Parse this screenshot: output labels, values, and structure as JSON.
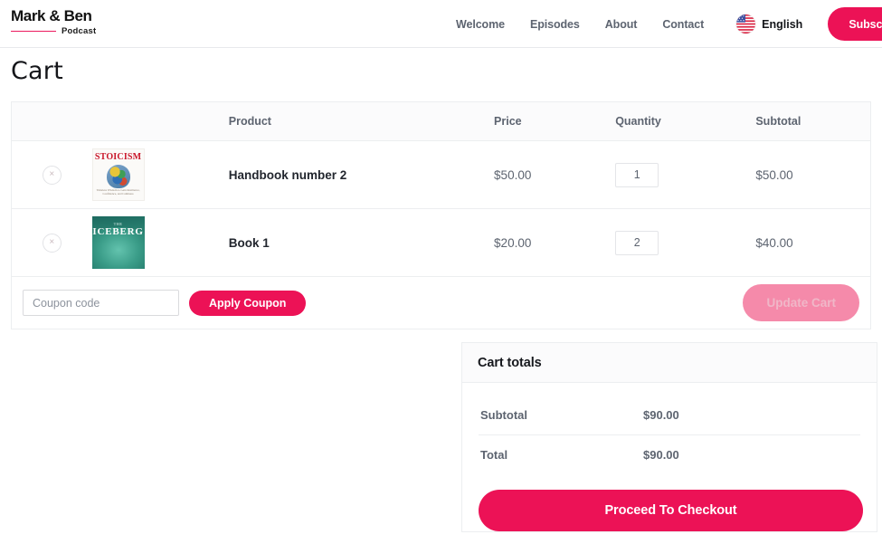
{
  "header": {
    "brand": {
      "name": "Mark & Ben",
      "tagline": "Podcast",
      "accent_color": "#ec1a5e"
    },
    "nav": [
      {
        "label": "Welcome",
        "name": "nav-link-welcome"
      },
      {
        "label": "Episodes",
        "name": "nav-link-episodes"
      },
      {
        "label": "About",
        "name": "nav-link-about"
      },
      {
        "label": "Contact",
        "name": "nav-link-contact"
      }
    ],
    "language": {
      "label": "English",
      "flag": "us-flag-icon"
    },
    "subscribe_label": "Subscribe"
  },
  "page": {
    "title": "Cart"
  },
  "cart": {
    "columns": {
      "remove": "",
      "thumbnail": "",
      "product": "Product",
      "price": "Price",
      "quantity": "Quantity",
      "subtotal": "Subtotal"
    },
    "items": [
      {
        "remove_label": "×",
        "thumb": {
          "kind": "stoicism-book-cover",
          "title": "STOICISM",
          "subtitle": "Timeless Wisdom to Gain Resilience, Confidence, and Calmness"
        },
        "name": "Handbook number 2",
        "price": "$50.00",
        "quantity": "1",
        "subtotal": "$50.00"
      },
      {
        "remove_label": "×",
        "thumb": {
          "kind": "iceberg-book-cover",
          "eyebrow": "THE",
          "title": "ICEBERG"
        },
        "name": "Book 1",
        "price": "$20.00",
        "quantity": "2",
        "subtotal": "$40.00"
      }
    ],
    "coupon": {
      "placeholder": "Coupon code",
      "value": "",
      "apply_label": "Apply Coupon"
    },
    "update_label": "Update Cart"
  },
  "totals": {
    "title": "Cart totals",
    "rows": [
      {
        "label": "Subtotal",
        "value": "$90.00"
      },
      {
        "label": "Total",
        "value": "$90.00"
      }
    ],
    "checkout_label": "Proceed To Checkout"
  },
  "colors": {
    "brand_pink": "#ec1256",
    "brand_pink_muted": "#f58aaa",
    "text_muted": "#5d6470",
    "border": "#eceef0"
  }
}
